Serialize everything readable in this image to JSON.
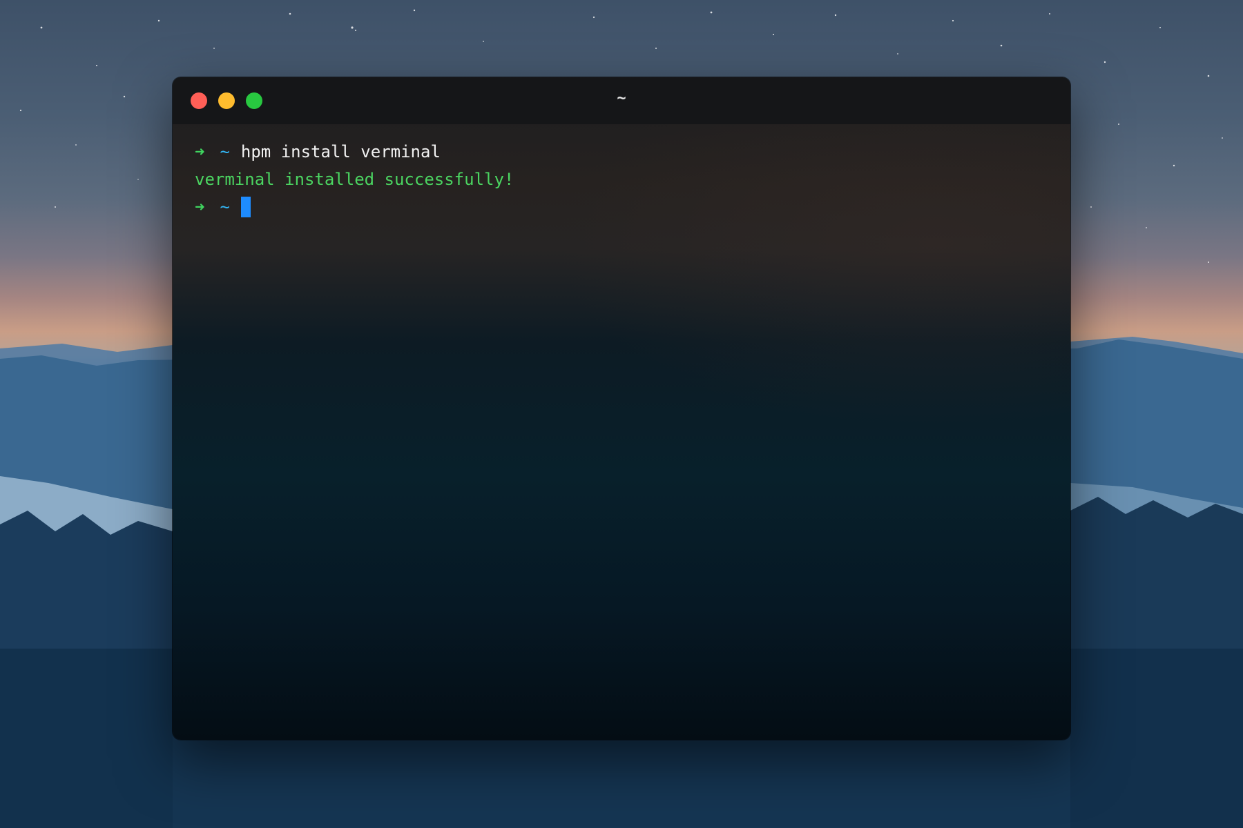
{
  "window": {
    "title": "~"
  },
  "terminal": {
    "lines": [
      {
        "prompt_symbol": "➜",
        "directory": "~",
        "command": "hpm install verminal"
      },
      {
        "output": "verminal installed successfully!"
      },
      {
        "prompt_symbol": "➜",
        "directory": "~",
        "command": ""
      }
    ]
  },
  "colors": {
    "close_button": "#ff5f57",
    "minimize_button": "#febc2e",
    "maximize_button": "#28c840",
    "prompt_arrow": "#3fd45f",
    "prompt_directory": "#33b6f5",
    "success_output": "#4bd561",
    "cursor": "#1e8cff"
  },
  "icons": {
    "close": "close-icon",
    "minimize": "minimize-icon",
    "maximize": "maximize-icon",
    "prompt": "arrow-right-icon",
    "cursor": "block-cursor-icon"
  }
}
